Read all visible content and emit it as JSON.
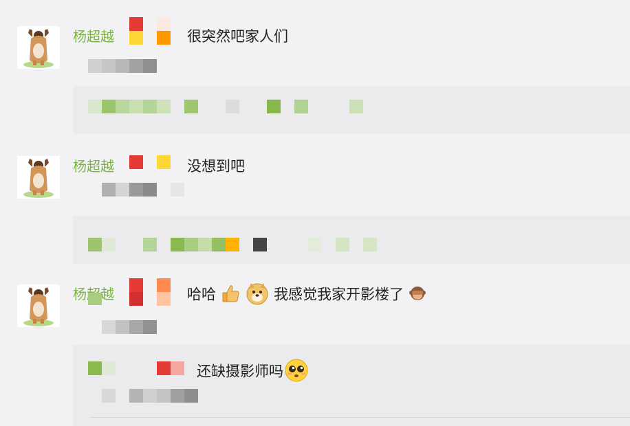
{
  "comments": [
    {
      "author": "杨超越",
      "text": "很突然吧家人们",
      "meta": "",
      "badge_colors": [
        "#e53935",
        "#fdd835",
        "#ff9800"
      ]
    },
    {
      "author": "杨超越",
      "text": "没想到吧",
      "meta": "",
      "badge_colors": [
        "#e53935",
        "#fdd835"
      ]
    },
    {
      "author": "杨超越",
      "text_parts": [
        "哈哈",
        "我感觉我家开影楼了"
      ],
      "icons": [
        "thumbs-up-icon",
        "doge-icon",
        "see-no-evil-monkey-icon"
      ],
      "badge_colors": [
        "#e53935",
        "#ff8a50"
      ],
      "reply": {
        "text": "还缺摄影师吗",
        "icon": "pleading-face-icon"
      }
    }
  ],
  "colors": {
    "author": "#7cb342",
    "background": "#f2f2f4",
    "reply_box": "#ebebed"
  }
}
